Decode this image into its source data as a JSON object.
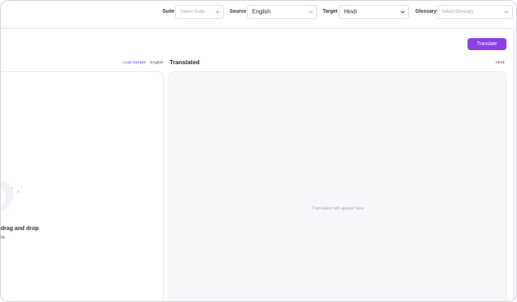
{
  "toolbar": {
    "suite_label": "Suite",
    "suite_placeholder": "Select Suite",
    "source_label": "Source",
    "source_value": "English",
    "target_label": "Target",
    "target_value": "Hindi",
    "glossary_label": "Glossary",
    "glossary_placeholder": "Select Glossary"
  },
  "actions": {
    "translate_label": "Translate"
  },
  "source_pane": {
    "load_sample": "Load Sample",
    "language": "English",
    "upload_title_partial": "drag and drop",
    "upload_sub_partial": "ile"
  },
  "target_pane": {
    "title": "Translated",
    "language": "Hindi",
    "placeholder": "Translation will appear here"
  },
  "colors": {
    "accent": "#8b3fe8",
    "link": "#7c3aed"
  },
  "icons": [
    "chevron-down-icon",
    "upload-icon"
  ]
}
